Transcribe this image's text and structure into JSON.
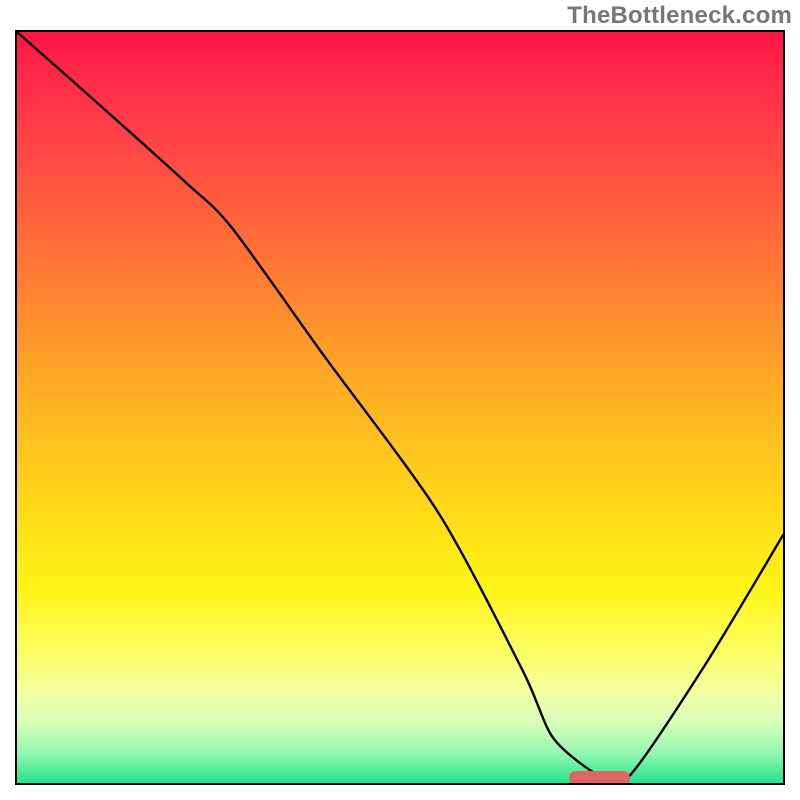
{
  "watermark": "TheBottleneck.com",
  "chart_data": {
    "type": "line",
    "title": "",
    "xlabel": "",
    "ylabel": "",
    "xlim": [
      0,
      100
    ],
    "ylim": [
      0,
      100
    ],
    "grid": false,
    "legend": false,
    "series": [
      {
        "name": "bottleneck-curve",
        "x": [
          0,
          10,
          22,
          28,
          40,
          55,
          66,
          70,
          76,
          80,
          90,
          100
        ],
        "y": [
          100,
          91,
          80,
          74,
          57,
          36,
          15,
          6,
          1,
          1,
          16,
          33
        ]
      }
    ],
    "annotations": [
      {
        "name": "optimal-range",
        "x_start": 72,
        "x_end": 80,
        "y": 0.6,
        "color": "#e06666"
      }
    ],
    "background_gradient": {
      "orientation": "vertical",
      "stops": [
        {
          "pos": 0.0,
          "color": "#ff1446"
        },
        {
          "pos": 0.5,
          "color": "#ffbf22"
        },
        {
          "pos": 0.8,
          "color": "#fff860"
        },
        {
          "pos": 1.0,
          "color": "#22e58a"
        }
      ]
    }
  }
}
